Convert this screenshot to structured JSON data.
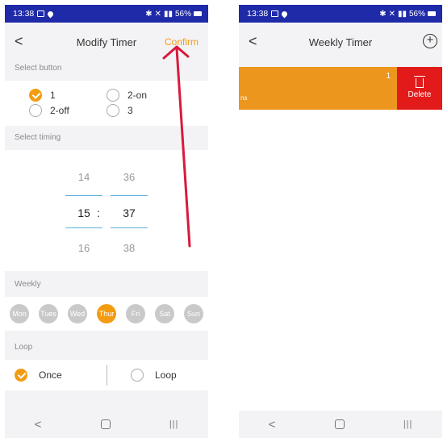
{
  "statusbar": {
    "time": "13:38",
    "battery": "56%"
  },
  "left": {
    "title": "Modify Timer",
    "back_icon": "chevron-left",
    "confirm": "Confirm",
    "select_button_label": "Select button",
    "buttons": [
      {
        "label": "1",
        "checked": true
      },
      {
        "label": "2-on",
        "checked": false
      },
      {
        "label": "2-off",
        "checked": false
      },
      {
        "label": "3",
        "checked": false
      }
    ],
    "select_timing_label": "Select timing",
    "timing": {
      "hours": [
        "14",
        "15",
        "16"
      ],
      "minutes": [
        "36",
        "37",
        "38"
      ],
      "separator": ":",
      "selected_hour": "15",
      "selected_minute": "37"
    },
    "weekly_label": "Weekly",
    "days": [
      {
        "label": "Mon",
        "selected": false
      },
      {
        "label": "Tues",
        "selected": false
      },
      {
        "label": "Wed",
        "selected": false
      },
      {
        "label": "Thur",
        "selected": true
      },
      {
        "label": "Fri",
        "selected": false
      },
      {
        "label": "Sat",
        "selected": false
      },
      {
        "label": "Sun",
        "selected": false
      }
    ],
    "loop_label": "Loop",
    "loop_options": [
      {
        "label": "Once",
        "checked": true
      },
      {
        "label": "Loop",
        "checked": false
      }
    ]
  },
  "right": {
    "title": "Weekly Timer",
    "back_icon": "chevron-left",
    "add_icon": "plus-circle-icon",
    "timer_item": {
      "number": "1",
      "fragment": "ns"
    },
    "delete_label": "Delete"
  },
  "colors": {
    "accent": "#f39c12",
    "statusbar": "#1f2aa8",
    "delete": "#e31a1a",
    "arrow": "#d9193b",
    "picker_line": "#5ab2e0"
  }
}
